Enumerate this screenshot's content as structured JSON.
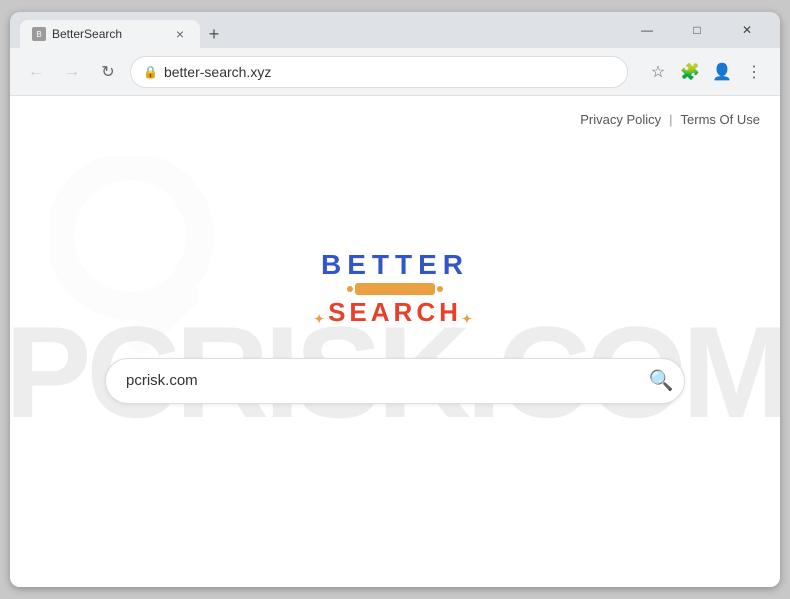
{
  "browser": {
    "tab_title": "BetterSearch",
    "tab_favicon": "B",
    "close_tab_label": "×",
    "new_tab_label": "+",
    "minimize_label": "—",
    "maximize_label": "□",
    "close_window_label": "✕",
    "back_label": "←",
    "forward_label": "→",
    "reload_label": "↻",
    "address": "better-search.xyz",
    "bookmark_label": "☆",
    "extensions_label": "🧩",
    "profile_label": "👤",
    "menu_label": "⋮"
  },
  "page": {
    "privacy_policy_label": "Privacy Policy",
    "divider": "|",
    "terms_label": "Terms Of Use",
    "watermark": "PCRISK.COM",
    "logo_better": "BETTER",
    "logo_search": "SEARCH",
    "search_placeholder": "pcrisk.com",
    "search_button_label": "🔍"
  }
}
